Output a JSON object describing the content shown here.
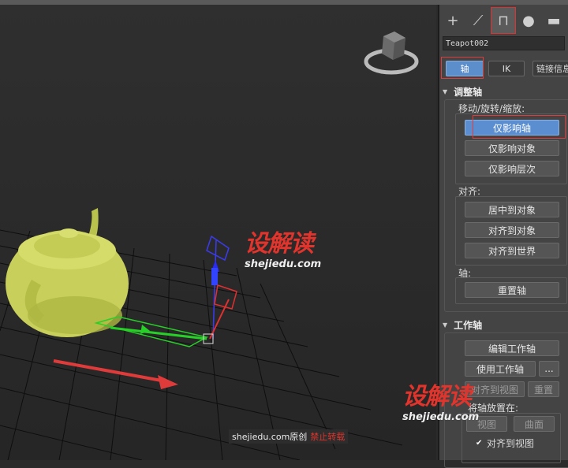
{
  "viewport": {
    "label": "",
    "watermark": {
      "logo": "设解读",
      "url": "shejiedu.com"
    },
    "credit": {
      "site": "shejiedu.com原创",
      "notice": "禁止转载"
    }
  },
  "panel": {
    "tabs": [
      {
        "icon": "plus-icon",
        "glyph": "+"
      },
      {
        "icon": "modify-icon",
        "glyph": "⟋"
      },
      {
        "icon": "hierarchy-icon",
        "glyph": "⊓"
      },
      {
        "icon": "motion-icon",
        "glyph": "●"
      },
      {
        "icon": "display-icon",
        "glyph": "▬"
      }
    ],
    "object_name": "Teapot002",
    "subtabs": {
      "pivot": "轴",
      "ik": "IK",
      "link_info": "链接信息"
    },
    "adjust_pivot": {
      "title": "调整轴",
      "move_rotate_scale": "移动/旋转/缩放:",
      "affect_pivot_only": "仅影响轴",
      "affect_object_only": "仅影响对象",
      "affect_hierarchy_only": "仅影响层次",
      "alignment": "对齐:",
      "center_to_object": "居中到对象",
      "align_to_object": "对齐到对象",
      "align_to_world": "对齐到世界",
      "pivot": "轴:",
      "reset_pivot": "重置轴"
    },
    "working_pivot": {
      "title": "工作轴",
      "edit_working_pivot": "编辑工作轴",
      "use_working_pivot": "使用工作轴",
      "dots": "...",
      "align_to_view": "对齐到视图",
      "reset": "重置",
      "place_pivot_to": "将轴放置在:",
      "view": "视图",
      "surface": "曲面",
      "align_to_view_check": "对齐到视图"
    },
    "watermark": {
      "logo": "设解读",
      "url": "shejiedu.com"
    }
  },
  "colors": {
    "accent": "#5a8ed0",
    "highlight": "#e23b3b",
    "teapot": "#c8cf5a"
  }
}
